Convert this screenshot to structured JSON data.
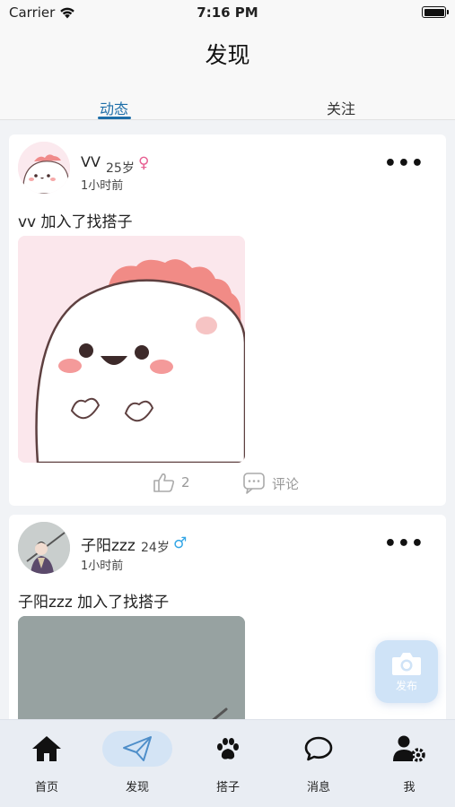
{
  "status": {
    "carrier": "Carrier",
    "time": "7:16 PM"
  },
  "header": {
    "title": "发现",
    "tabs": [
      {
        "label": "动态",
        "active": true
      },
      {
        "label": "关注",
        "active": false
      }
    ]
  },
  "posts": [
    {
      "username": "VV",
      "age": "25岁",
      "gender_symbol": "♀",
      "time_ago": "1小时前",
      "text": "vv 加入了找搭子",
      "likes": "2",
      "comment_label": "评论"
    },
    {
      "username": "子阳zzz",
      "age": "24岁",
      "gender_symbol": "♂",
      "time_ago": "1小时前",
      "text": "子阳zzz 加入了找搭子"
    }
  ],
  "fab": {
    "label": "发布"
  },
  "tabbar": [
    {
      "label": "首页",
      "icon": "home-icon"
    },
    {
      "label": "发现",
      "icon": "paper-plane-icon",
      "active": true
    },
    {
      "label": "搭子",
      "icon": "paw-icon"
    },
    {
      "label": "消息",
      "icon": "chat-bubble-icon"
    },
    {
      "label": "我",
      "icon": "user-settings-icon"
    }
  ],
  "colors": {
    "accent": "#1d6ea8",
    "female": "#e75f92",
    "male": "#33a6e6",
    "fab_bg": "#cfe3f7",
    "tabbar_bg": "#e9edf3"
  }
}
